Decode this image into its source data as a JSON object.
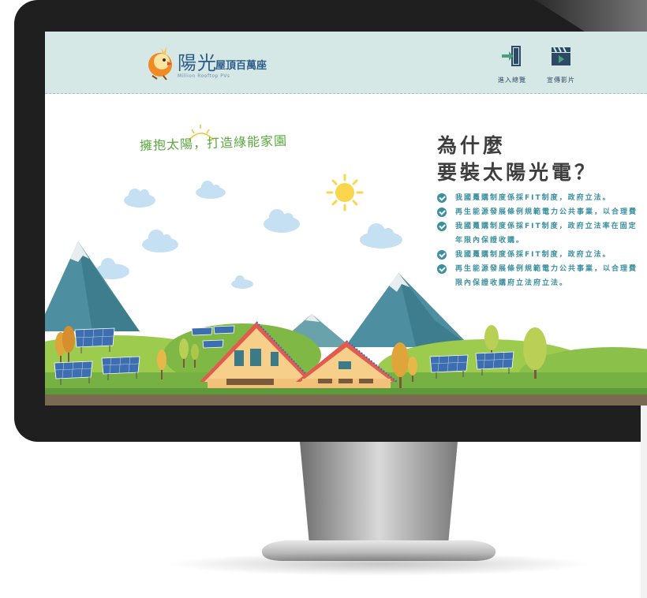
{
  "header": {
    "logo_title": "陽光",
    "logo_subtitle": "屋頂百萬座",
    "logo_english": "Million Rooftop PVs",
    "nav": [
      {
        "label": "進入總覽",
        "icon": "enter-door-icon"
      },
      {
        "label": "宣傳影片",
        "icon": "video-clapper-icon"
      }
    ]
  },
  "hero": {
    "tagline": "擁抱太陽，打造綠能家園",
    "title_line1": "為什麼",
    "title_line2": "要裝太陽光電？",
    "bullets": [
      {
        "text": "我國躉購制度係採FIT制度，政府立法。",
        "checked": true
      },
      {
        "text": "再生能源發展條例規範電力公共事業，以合理費",
        "checked": true
      },
      {
        "text": "我國躉購制度係採FIT制度，政府立法率在固定",
        "checked": true
      },
      {
        "text": "年限內保證收購。",
        "checked": false
      },
      {
        "text": "我國躉購制度係採FIT制度，政府立法。",
        "checked": true
      },
      {
        "text": "再生能源發展條例規範電力公共事業，以合理費",
        "checked": true
      },
      {
        "text": "限內保證收購府立法府立法。",
        "checked": false
      }
    ]
  },
  "colors": {
    "header_bg": "#d6e8e6",
    "accent": "#3a8fa0",
    "title": "#3e3e3e",
    "tagline": "#5aa83f",
    "sun": "#f9d64b",
    "bezel": "#1f1f1f"
  }
}
